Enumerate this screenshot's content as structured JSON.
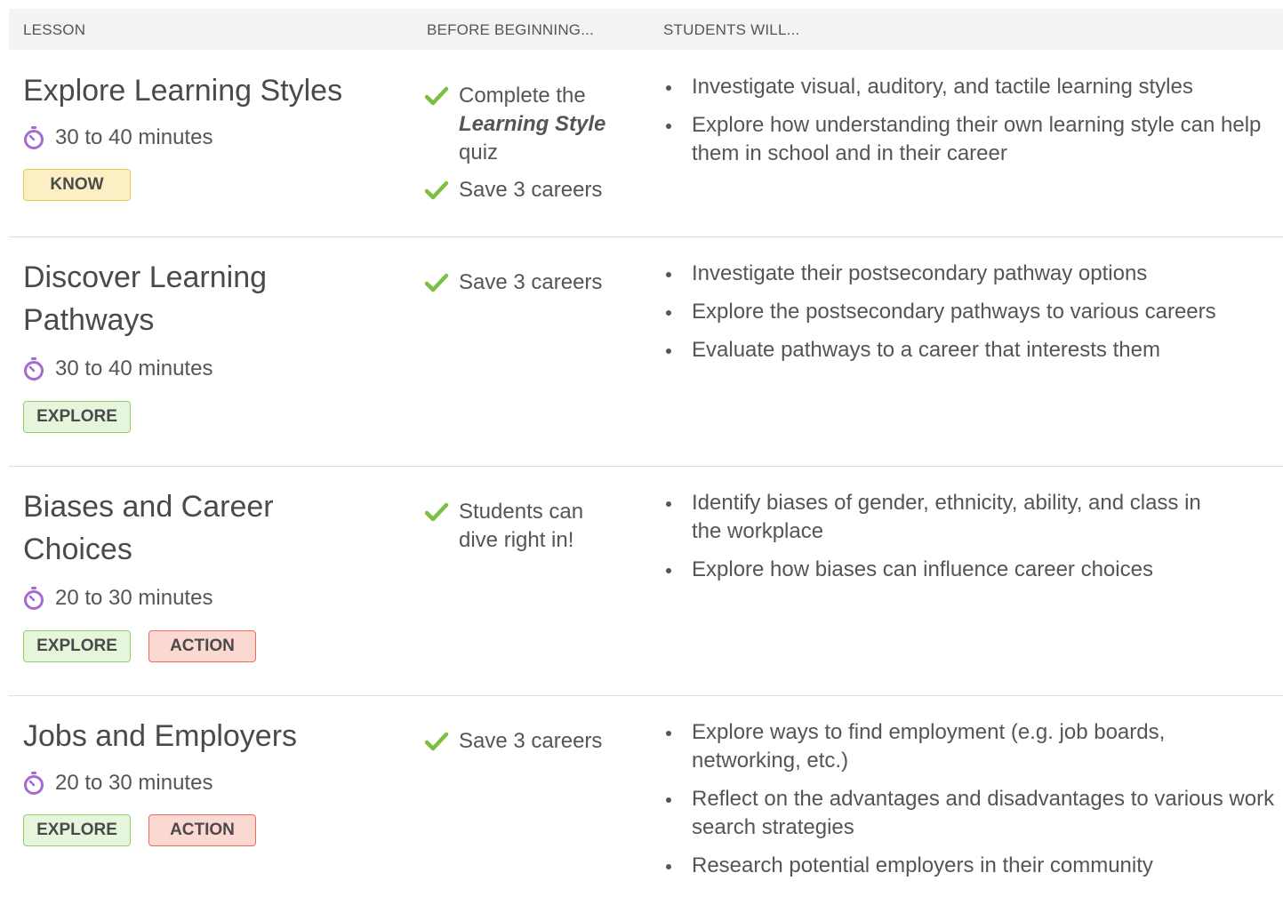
{
  "header": {
    "lesson": "LESSON",
    "before": "BEFORE BEGINNING...",
    "students": "STUDENTS WILL..."
  },
  "colors": {
    "check": "#7ac142",
    "timer": "#a66bd1",
    "know_bg": "#fdefc4",
    "explore_bg": "#e6f6dc",
    "action_bg": "#fbd8d1"
  },
  "lessons": [
    {
      "title": "Explore Learning Styles",
      "duration": "30 to 40 minutes",
      "badges": [
        "KNOW"
      ],
      "before": [
        {
          "pre": "Complete the",
          "em": "Learning Style",
          "post": "quiz"
        },
        {
          "text": "Save 3 careers"
        }
      ],
      "will": [
        "Investigate visual, auditory, and tactile learning styles",
        "Explore how understanding their own learning style can help them in school and in their career"
      ]
    },
    {
      "title": "Discover Learning Pathways",
      "duration": "30 to 40 minutes",
      "badges": [
        "EXPLORE"
      ],
      "before": [
        {
          "text": "Save 3 careers"
        }
      ],
      "will": [
        "Investigate their postsecondary pathway options",
        "Explore the postsecondary pathways to various careers",
        "Evaluate pathways to a career that interests them"
      ]
    },
    {
      "title": "Biases and Career Choices",
      "duration": "20 to 30 minutes",
      "badges": [
        "EXPLORE",
        "ACTION"
      ],
      "before": [
        {
          "text": "Students can dive right in!"
        }
      ],
      "will": [
        "Identify biases of gender, ethnicity, ability, and class in the workplace",
        "Explore how biases can influence career choices"
      ]
    },
    {
      "title": "Jobs and Employers",
      "duration": "20 to 30 minutes",
      "badges": [
        "EXPLORE",
        "ACTION"
      ],
      "before": [
        {
          "text": "Save 3 careers"
        }
      ],
      "will": [
        "Explore ways to find employment (e.g. job boards, networking, etc.)",
        "Reflect on the advantages and disadvantages to various work search strategies",
        "Research potential employers in their community"
      ]
    }
  ]
}
